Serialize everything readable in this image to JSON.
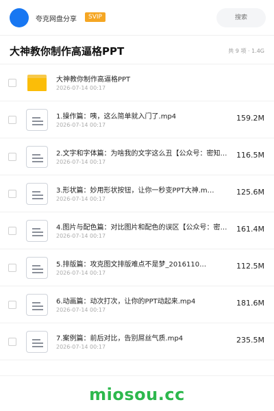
{
  "header": {
    "app_name": "夸克网盘分享",
    "badge": "SVIP",
    "search_placeholder": "搜索"
  },
  "folder": {
    "title": "大神教你制作高逼格PPT",
    "meta": "共 9 项 · 1.4G"
  },
  "files": [
    {
      "name": "大神教你制作高逼格PPT",
      "date": "2026-07-14 00:17",
      "size": "",
      "type": "folder"
    },
    {
      "name": "1.操作篇：咦，这么简单就入门了.mp4",
      "date": "2026-07-14 00:17",
      "size": "159.2M",
      "type": "file"
    },
    {
      "name": "2.文字和字体篇：为啥我的文字这么丑【公众号：密知…",
      "date": "2026-07-14 00:17",
      "size": "116.5M",
      "type": "file"
    },
    {
      "name": "3.形状篇：妙用形状按钮，让你一秒变PPT大神.m…",
      "date": "2026-07-14 00:17",
      "size": "125.6M",
      "type": "file"
    },
    {
      "name": "4.图片与配色篇：对比图片和配色的误区【公众号：密…",
      "date": "2026-07-14 00:17",
      "size": "161.4M",
      "type": "file"
    },
    {
      "name": "5.排版篇：攻克图文排版难点不是梦_2016110…",
      "date": "2026-07-14 00:17",
      "size": "112.5M",
      "type": "file"
    },
    {
      "name": "6.动画篇：动次打次，让你的PPT动起来.mp4",
      "date": "2026-07-14 00:17",
      "size": "181.6M",
      "type": "file"
    },
    {
      "name": "7.案例篇：前后对比，告别屌丝气质.mp4",
      "date": "2026-07-14 00:17",
      "size": "235.5M",
      "type": "file"
    }
  ],
  "watermark": "miosou.cc",
  "colors": {
    "avatar": "#1877f2",
    "badge": "#f5a623",
    "folder": "#fbbd08",
    "watermark": "#2db84d"
  },
  "icons": {
    "folder": "folder-icon",
    "file": "document-icon"
  }
}
